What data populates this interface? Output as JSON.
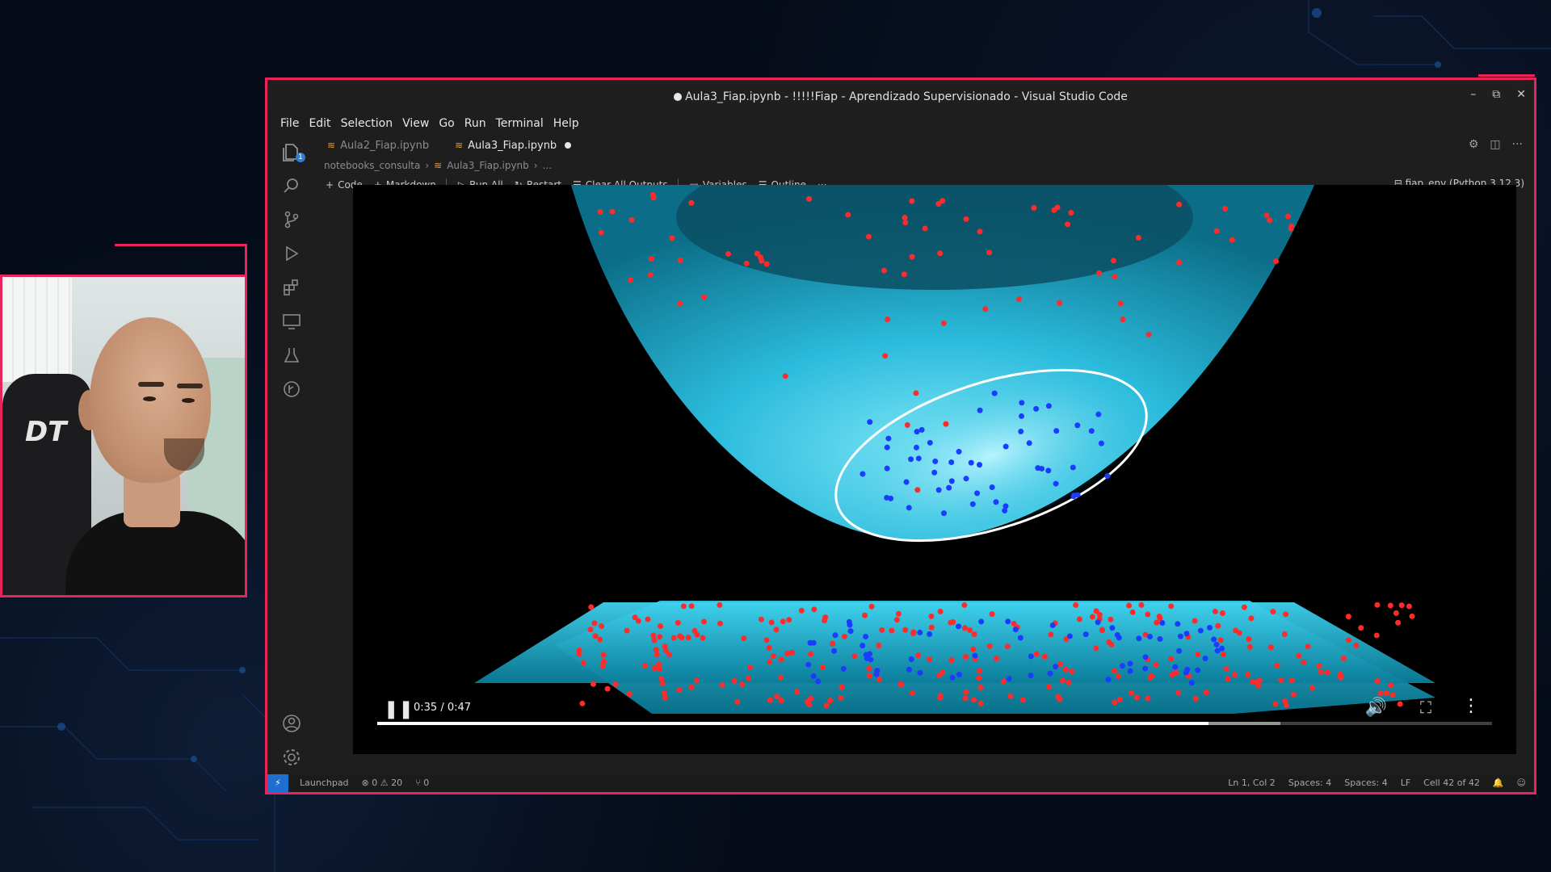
{
  "window": {
    "title": "Aula3_Fiap.ipynb - !!!!!Fiap - Aprendizado Supervisionado - Visual Studio Code",
    "controls": [
      "–",
      "⧉",
      "✕"
    ]
  },
  "menu": [
    "File",
    "Edit",
    "Selection",
    "View",
    "Go",
    "Run",
    "Terminal",
    "Help"
  ],
  "activity_badge": "1",
  "tabs": [
    {
      "label": "Aula2_Fiap.ipynb",
      "active": false
    },
    {
      "label": "Aula3_Fiap.ipynb",
      "active": true
    }
  ],
  "breadcrumb": [
    "notebooks_consulta",
    "Aula3_Fiap.ipynb",
    "..."
  ],
  "toolbar": {
    "code": "Code",
    "markdown": "Markdown",
    "run_all": "Run All",
    "restart": "Restart",
    "clear": "Clear All Outputs",
    "variables": "Variables",
    "outline": "Outline",
    "more": "···"
  },
  "kernel": "fiap_env (Python 3.12.3)",
  "video": {
    "time": "0:35 / 0:47",
    "progress": 0.746,
    "buffered": 0.81
  },
  "statusbar": {
    "launchpad": "Launchpad",
    "problems": "⊗ 0 ⚠ 20",
    "ports": "⑂ 0",
    "position": "Ln 1, Col 2",
    "spaces1": "Spaces: 4",
    "spaces2": "Spaces: 4",
    "eol": "LF",
    "cell": "Cell 42 of 42"
  },
  "colors": {
    "frame_accent": "#e8245a",
    "surface": "#33c3e0",
    "class_a": "#ff2a2a",
    "class_b": "#1a3cff"
  }
}
